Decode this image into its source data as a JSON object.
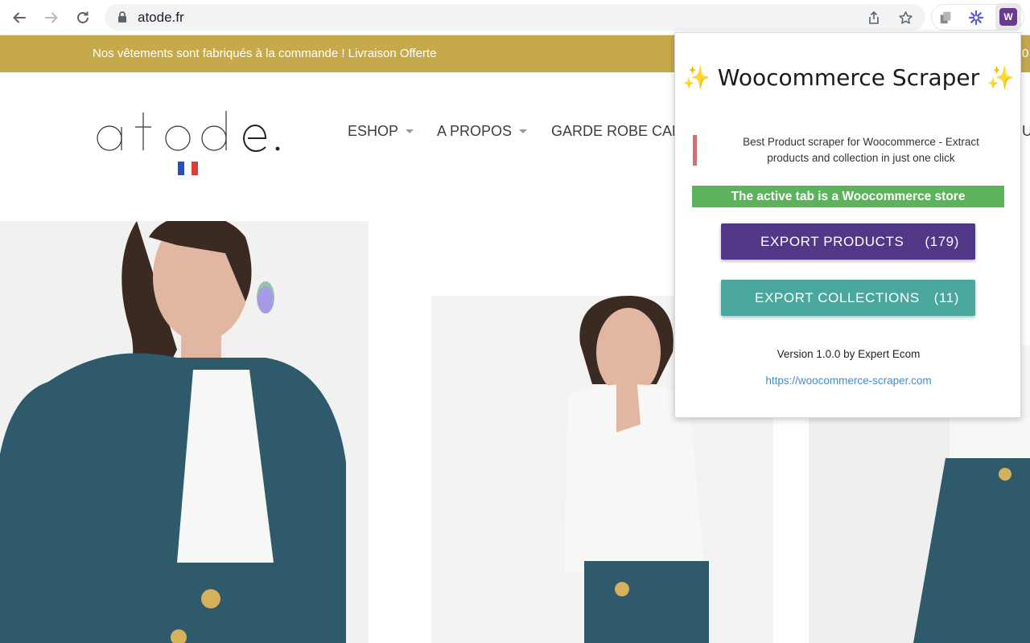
{
  "browser": {
    "url": "atode.fr"
  },
  "site": {
    "announcement": "Nos vêtements sont fabriqués à la commande ! Livraison Offerte",
    "announcement_right": "0",
    "menu": [
      {
        "label": "ESHOP",
        "has_caret": true
      },
      {
        "label": "A PROPOS",
        "has_caret": true
      },
      {
        "label": "GARDE ROBE CAP",
        "has_caret": false
      }
    ],
    "menu_right_fragment": "U"
  },
  "popup": {
    "title": "Woocommerce Scraper",
    "title_icon": "sparkles",
    "description": "Best Product scraper for Woocommerce - Extract products and collection in just one click",
    "status": "The active tab is a Woocommerce store",
    "export_products_label": "EXPORT PRODUCTS",
    "export_products_count": "(179)",
    "export_collections_label": "EXPORT COLLECTIONS",
    "export_collections_count": "(11)",
    "version": "Version 1.0.0 by Expert Ecom",
    "link": "https://woocommerce-scraper.com",
    "colors": {
      "products_button": "#503887",
      "collections_button": "#4aa79d",
      "status_bar": "#5cb35c",
      "quote_bar": "#e06a6a"
    }
  },
  "colors": {
    "announcement_bar": "#c6a94b"
  }
}
